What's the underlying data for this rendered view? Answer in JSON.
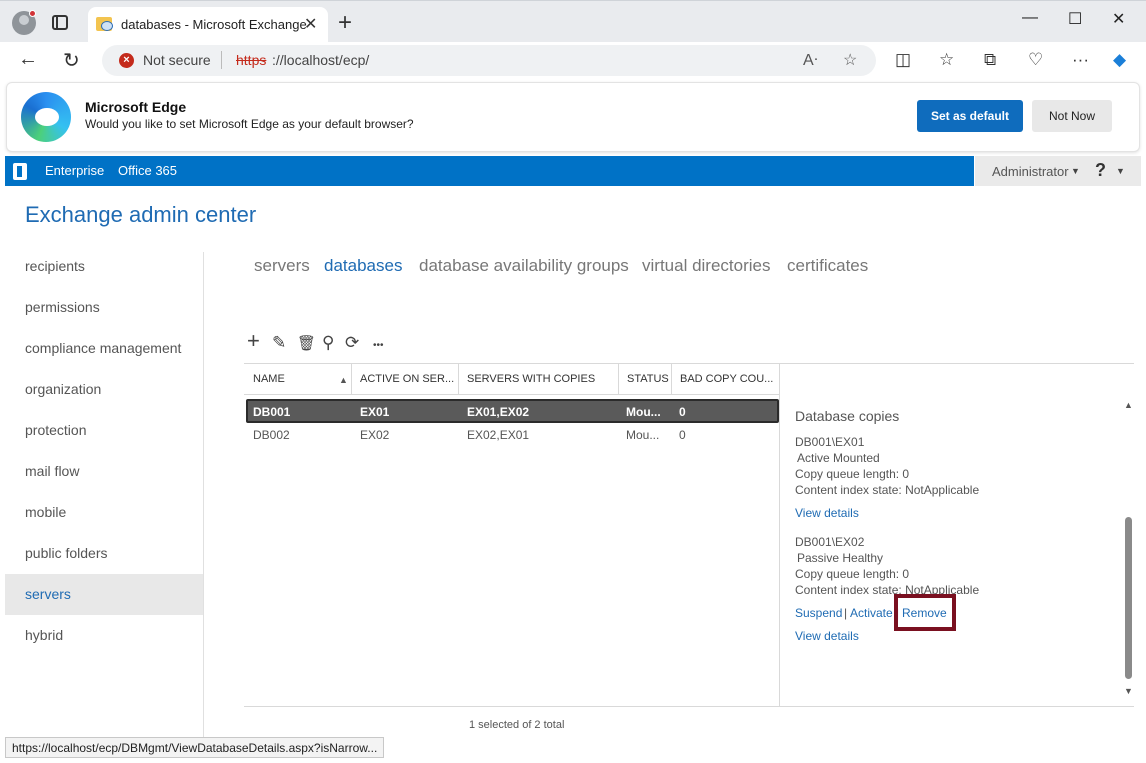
{
  "browser": {
    "tab_title": "databases - Microsoft Exchange",
    "tab_close": "✕",
    "new_tab": "+",
    "window_controls": {
      "minimize": "—",
      "maximize": "☐",
      "close": "✕"
    },
    "security_label": "Not secure",
    "url_scheme": "https",
    "url_rest": "://localhost/ecp/",
    "status_url": "https://localhost/ecp/DBMgmt/ViewDatabaseDetails.aspx?isNarrow..."
  },
  "banner": {
    "title": "Microsoft Edge",
    "message": "Would you like to set Microsoft Edge as your default browser?",
    "set_default_label": "Set as default",
    "not_now_label": "Not Now"
  },
  "header": {
    "links": [
      "Enterprise",
      "Office 365"
    ],
    "user": "Administrator",
    "help": "?",
    "app_title": "Exchange admin center"
  },
  "leftnav": {
    "items": [
      "recipients",
      "permissions",
      "compliance management",
      "organization",
      "protection",
      "mail flow",
      "mobile",
      "public folders",
      "servers",
      "hybrid"
    ],
    "selected": "servers"
  },
  "subtabs": {
    "items": [
      "servers",
      "databases",
      "database availability groups",
      "virtual directories",
      "certificates"
    ],
    "active": "databases"
  },
  "toolbar": {
    "icons": [
      "add-icon",
      "edit-icon",
      "delete-icon",
      "search-icon",
      "refresh-icon",
      "more-icon"
    ],
    "glyphs": {
      "add": "+",
      "edit": "✎",
      "delete": "🗑",
      "search": "⚲",
      "refresh": "⟳",
      "more": "•••"
    }
  },
  "grid": {
    "columns": [
      "NAME",
      "ACTIVE ON SER...",
      "SERVERS WITH COPIES",
      "STATUS",
      "BAD COPY COU..."
    ],
    "rows": [
      {
        "name": "DB001",
        "active_on": "EX01",
        "servers": "EX01,EX02",
        "status": "Mou...",
        "bad_copy": "0"
      },
      {
        "name": "DB002",
        "active_on": "EX02",
        "servers": "EX02,EX01",
        "status": "Mou...",
        "bad_copy": "0"
      }
    ],
    "footer": "1 selected of 2 total"
  },
  "details": {
    "title": "Database copies",
    "copies": [
      {
        "name": "DB001\\EX01",
        "state": "Active Mounted",
        "copy_queue": "Copy queue length: 0",
        "content_index": "Content index state: NotApplicable",
        "view_details": "View details"
      },
      {
        "name": "DB001\\EX02",
        "state": "Passive Healthy",
        "copy_queue": "Copy queue length: 0",
        "content_index": "Content index state: NotApplicable",
        "actions": [
          "Suspend",
          "Activate",
          "Remove"
        ],
        "separator": "|",
        "view_details": "View details"
      }
    ]
  },
  "colors": {
    "ecp_blue": "#0072c6",
    "link_blue": "#1f6bb3",
    "highlight": "#7a1020",
    "edge_button": "#0f6cbd"
  }
}
